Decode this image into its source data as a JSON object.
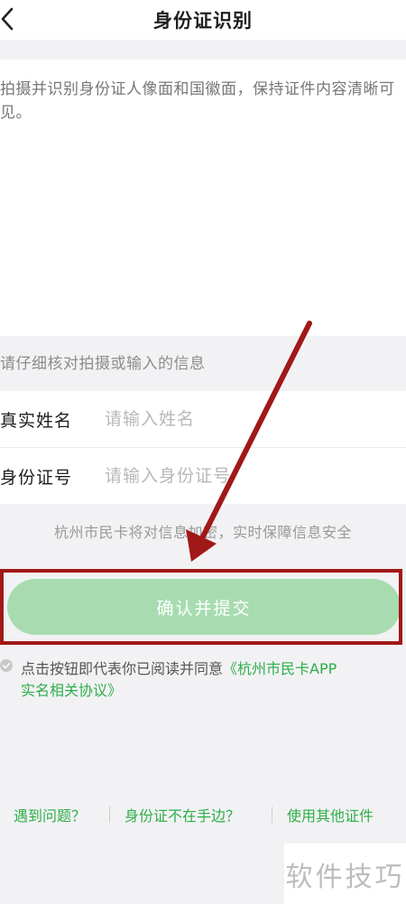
{
  "header": {
    "title": "身份证识别"
  },
  "upload": {
    "hint": "拍摄并识别身份证人像面和国徽面，保持证件内容清晰可见。"
  },
  "verify_tip": "请仔细核对拍摄或输入的信息",
  "form": {
    "name_label": "真实姓名",
    "name_placeholder": "请输入姓名",
    "id_label": "身份证号",
    "id_placeholder": "请输入身份证号"
  },
  "security_note": "杭州市民卡将对信息加密，实时保障信息安全",
  "submit_label": "确认并提交",
  "agreement": {
    "prefix": "点击按钮即代表你已阅读并同意",
    "link_part1": "《杭州市民卡APP",
    "link_part2": "实名相关协议》"
  },
  "footer_links": [
    "遇到问题？",
    "身份证不在手边？",
    "使用其他证件"
  ],
  "watermark": "软件技巧",
  "colors": {
    "accent": "#2fae4a",
    "button": "#a8dcb0",
    "annotation": "#a11818"
  },
  "icons": {
    "back": "chevron-left-icon",
    "check": "check-circle-icon"
  }
}
